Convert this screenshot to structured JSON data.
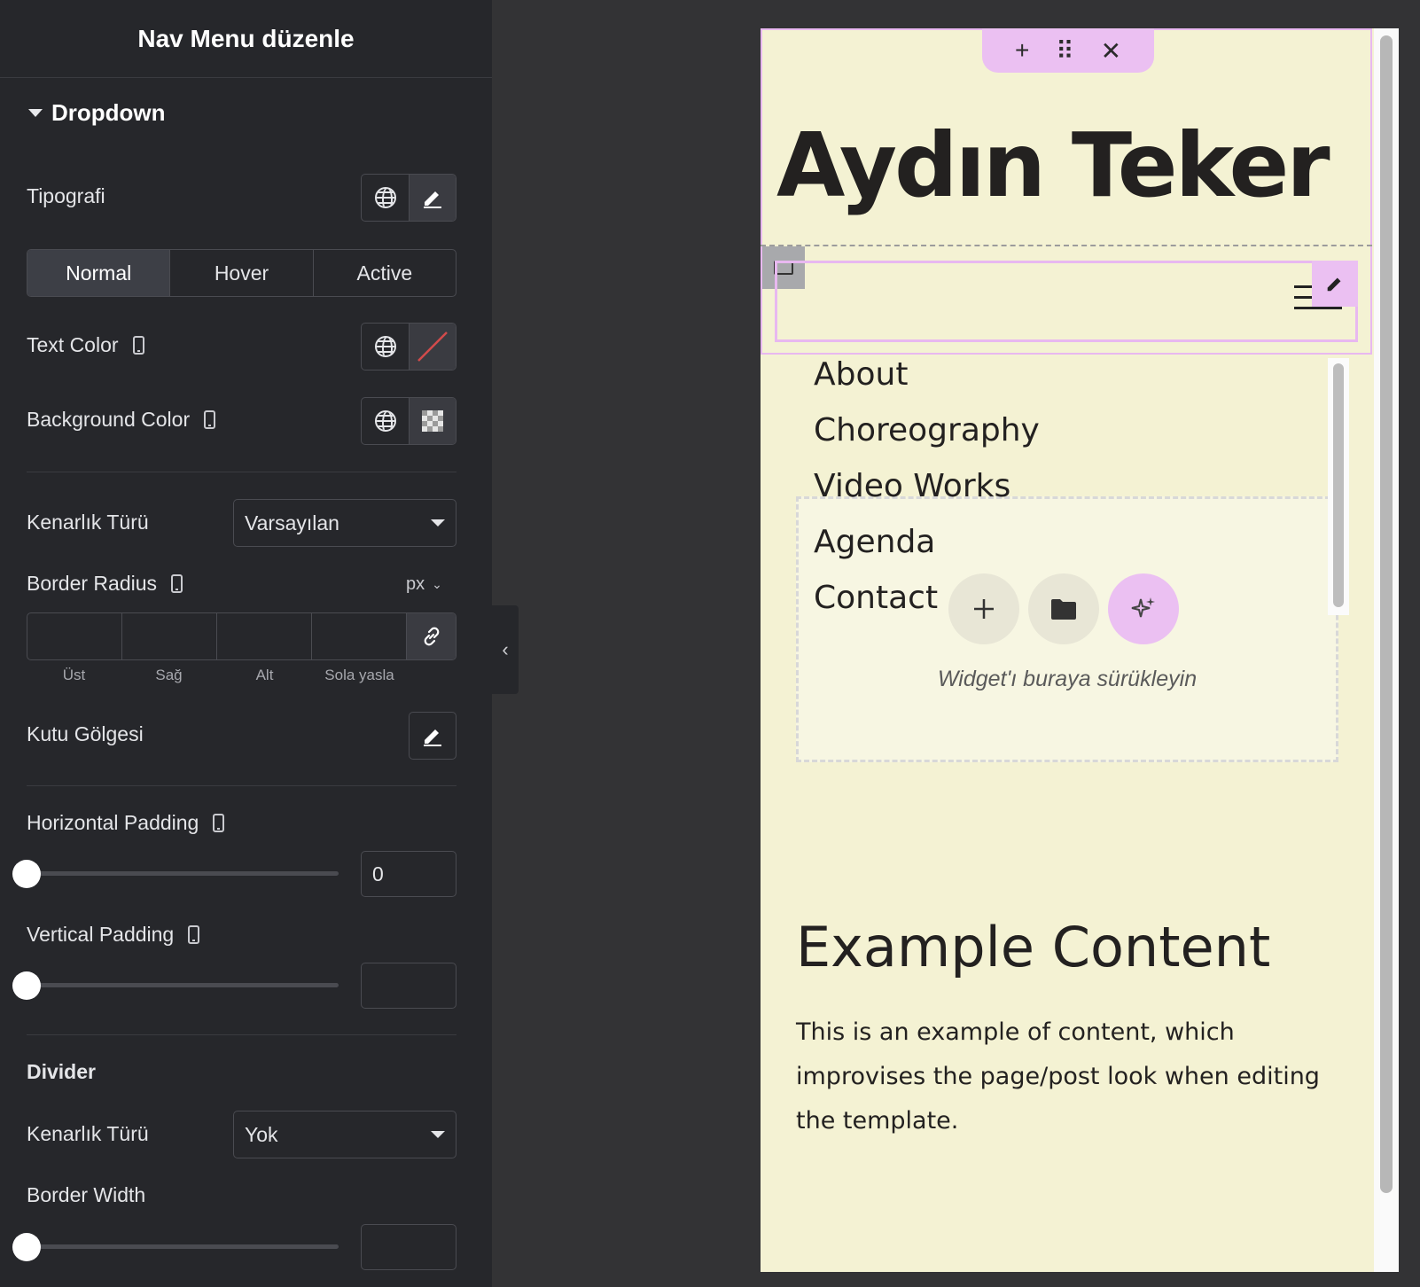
{
  "panel": {
    "title": "Nav Menu düzenle",
    "section": "Dropdown",
    "typography_label": "Tipografi",
    "tabs": [
      "Normal",
      "Hover",
      "Active"
    ],
    "text_color_label": "Text Color",
    "background_color_label": "Background Color",
    "border_type_label": "Kenarlık Türü",
    "border_type_value": "Varsayılan",
    "border_radius_label": "Border Radius",
    "unit": "px",
    "dims": [
      "Üst",
      "Sağ",
      "Alt",
      "Sola yasla"
    ],
    "box_shadow_label": "Kutu Gölgesi",
    "h_padding_label": "Horizontal Padding",
    "h_padding_value": "0",
    "v_padding_label": "Vertical Padding",
    "divider_label": "Divider",
    "divider_border_label": "Kenarlık Türü",
    "divider_border_value": "Yok",
    "border_width_label": "Border Width",
    "collapse_icon": "chevron-left-icon"
  },
  "preview": {
    "site_title": "Aydın Teker",
    "menu": [
      "About",
      "Choreography",
      "Video Works",
      "Agenda",
      "Contact"
    ],
    "drop_hint": "Widget'ı buraya sürükleyin",
    "example_title": "Example Content",
    "example_text": "This is an example of content, which improvises the page/post look when editing the template.",
    "toolbar": {
      "add": "+",
      "drag": "⠿",
      "close": "✕"
    }
  },
  "colors": {
    "panel_bg": "#26272b",
    "preview_bg": "#f4f2d3",
    "accent": "#ebc0f2"
  }
}
